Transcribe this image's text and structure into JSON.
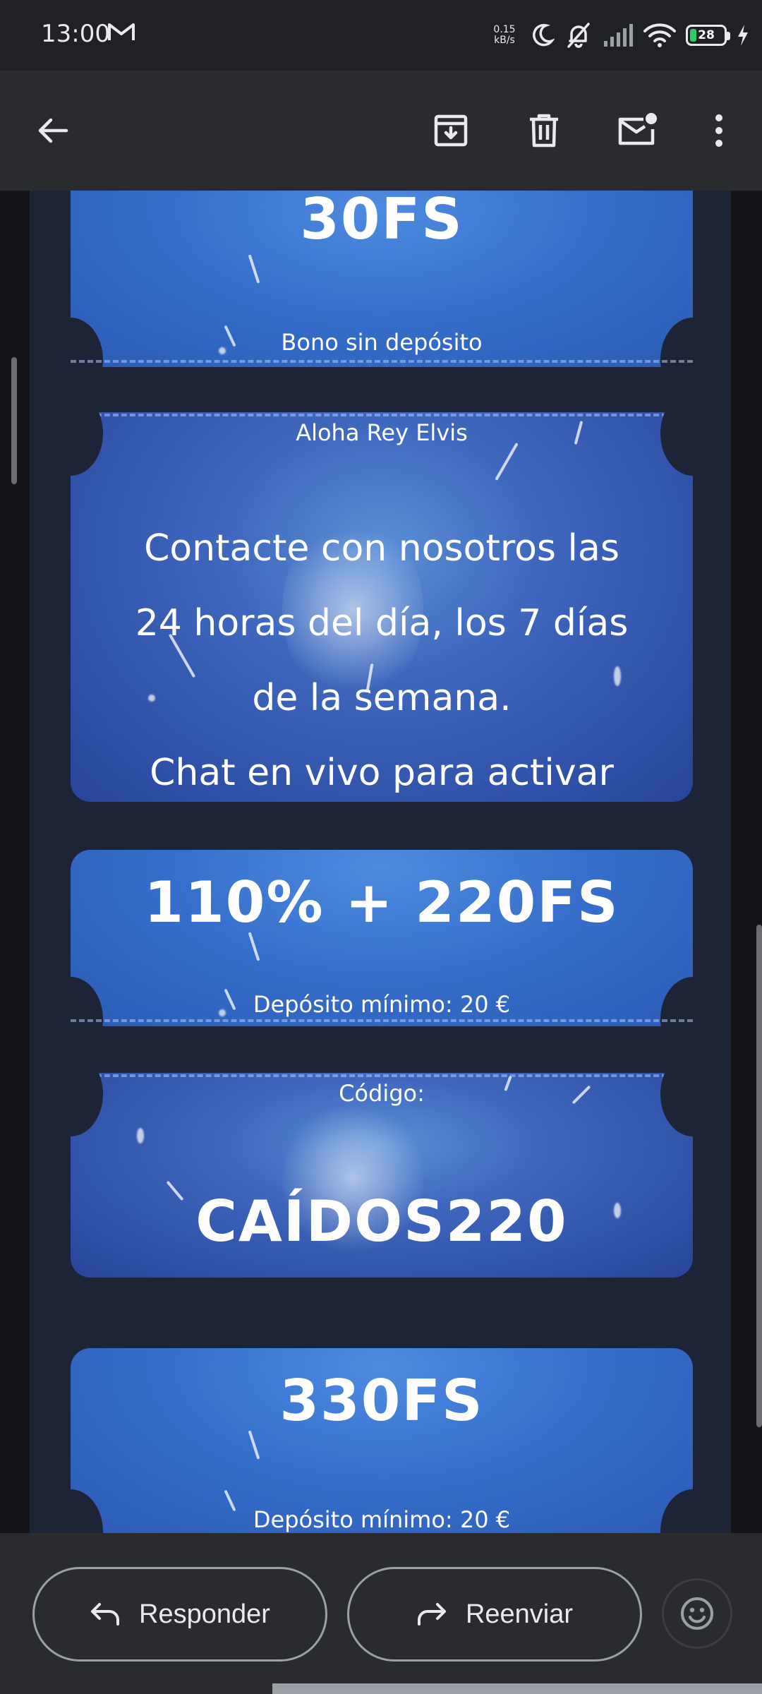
{
  "status_bar": {
    "time": "13:00",
    "net_speed_value": "0.15",
    "net_speed_unit": "kB/s",
    "battery_level": "28",
    "icons": [
      "gmail-icon",
      "moon-icon",
      "bell-off-icon",
      "signal-icon",
      "wifi-icon",
      "battery-icon",
      "charging-icon"
    ]
  },
  "toolbar": {
    "icons": [
      "back-arrow-icon",
      "archive-icon",
      "delete-icon",
      "mark-unread-icon",
      "more-vert-icon"
    ]
  },
  "email": {
    "ticket1": {
      "headline": "30FS",
      "sub": "Bono sin depósito"
    },
    "ticket2": {
      "top": "Aloha Rey Elvis",
      "lines": [
        "Contacte con nosotros las",
        "24 horas del día, los 7 días",
        "de la semana.",
        "Chat en vivo para activar"
      ]
    },
    "ticket3": {
      "headline": "110% + 220FS",
      "sub": "Depósito mínimo: 20 €"
    },
    "ticket4": {
      "top": "Código:",
      "code": "CAÍDOS220"
    },
    "ticket5": {
      "headline": "330FS",
      "sub": "Depósito mínimo: 20 €"
    }
  },
  "actions": {
    "reply_label": "Responder",
    "forward_label": "Reenviar",
    "icons": [
      "reply-icon",
      "forward-icon",
      "emoji-icon"
    ]
  },
  "colors": {
    "ticket_blue": "#3670cc",
    "frame_navy": "#1c2436",
    "bar_gray": "#2a2b2e",
    "battery_green": "#36c76a"
  }
}
